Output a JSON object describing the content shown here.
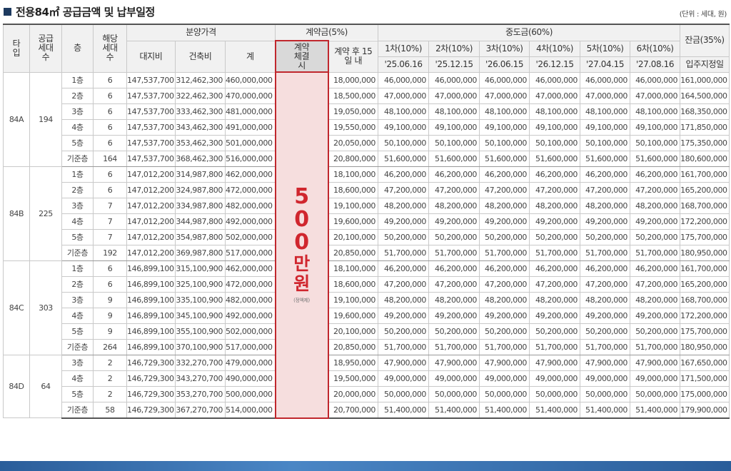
{
  "title": "전용84㎡ 공급금액 및 납부일정",
  "unit_note": "(단위 : 세대, 원)",
  "headers": {
    "type": "타입",
    "supply_units": "공급세대수",
    "floor": "층",
    "floor_units": "해당세대수",
    "price_group": "분양가격",
    "land": "대지비",
    "building": "건축비",
    "total": "계",
    "deposit_group": "계약금(5%)",
    "at_contract": "계약체결시",
    "within_15": "계약 후 15일 내",
    "middle_group": "중도금(60%)",
    "installments": [
      {
        "label": "1차(10%)",
        "date": "'25.06.16"
      },
      {
        "label": "2차(10%)",
        "date": "'25.12.15"
      },
      {
        "label": "3차(10%)",
        "date": "'26.06.15"
      },
      {
        "label": "4차(10%)",
        "date": "'26.12.15"
      },
      {
        "label": "5차(10%)",
        "date": "'27.04.15"
      },
      {
        "label": "6차(10%)",
        "date": "'27.08.16"
      }
    ],
    "balance": "잔금(35%)",
    "move_in": "입주지정일"
  },
  "contract_amount": {
    "digits": "500",
    "unit": "만원",
    "note": "(정액제)"
  },
  "groups": [
    {
      "type": "84A",
      "units": "194",
      "rows": [
        {
          "floor": "1층",
          "n": "6",
          "land": "147,537,700",
          "build": "312,462,300",
          "total": "460,000,000",
          "d15": "18,000,000",
          "mid": "46,000,000",
          "bal": "161,000,000"
        },
        {
          "floor": "2층",
          "n": "6",
          "land": "147,537,700",
          "build": "322,462,300",
          "total": "470,000,000",
          "d15": "18,500,000",
          "mid": "47,000,000",
          "bal": "164,500,000"
        },
        {
          "floor": "3층",
          "n": "6",
          "land": "147,537,700",
          "build": "333,462,300",
          "total": "481,000,000",
          "d15": "19,050,000",
          "mid": "48,100,000",
          "bal": "168,350,000"
        },
        {
          "floor": "4층",
          "n": "6",
          "land": "147,537,700",
          "build": "343,462,300",
          "total": "491,000,000",
          "d15": "19,550,000",
          "mid": "49,100,000",
          "bal": "171,850,000"
        },
        {
          "floor": "5층",
          "n": "6",
          "land": "147,537,700",
          "build": "353,462,300",
          "total": "501,000,000",
          "d15": "20,050,000",
          "mid": "50,100,000",
          "bal": "175,350,000"
        },
        {
          "floor": "기준층",
          "n": "164",
          "land": "147,537,700",
          "build": "368,462,300",
          "total": "516,000,000",
          "d15": "20,800,000",
          "mid": "51,600,000",
          "bal": "180,600,000"
        }
      ]
    },
    {
      "type": "84B",
      "units": "225",
      "rows": [
        {
          "floor": "1층",
          "n": "6",
          "land": "147,012,200",
          "build": "314,987,800",
          "total": "462,000,000",
          "d15": "18,100,000",
          "mid": "46,200,000",
          "bal": "161,700,000"
        },
        {
          "floor": "2층",
          "n": "6",
          "land": "147,012,200",
          "build": "324,987,800",
          "total": "472,000,000",
          "d15": "18,600,000",
          "mid": "47,200,000",
          "bal": "165,200,000"
        },
        {
          "floor": "3층",
          "n": "7",
          "land": "147,012,200",
          "build": "334,987,800",
          "total": "482,000,000",
          "d15": "19,100,000",
          "mid": "48,200,000",
          "bal": "168,700,000"
        },
        {
          "floor": "4층",
          "n": "7",
          "land": "147,012,200",
          "build": "344,987,800",
          "total": "492,000,000",
          "d15": "19,600,000",
          "mid": "49,200,000",
          "bal": "172,200,000"
        },
        {
          "floor": "5층",
          "n": "7",
          "land": "147,012,200",
          "build": "354,987,800",
          "total": "502,000,000",
          "d15": "20,100,000",
          "mid": "50,200,000",
          "bal": "175,700,000"
        },
        {
          "floor": "기준층",
          "n": "192",
          "land": "147,012,200",
          "build": "369,987,800",
          "total": "517,000,000",
          "d15": "20,850,000",
          "mid": "51,700,000",
          "bal": "180,950,000"
        }
      ]
    },
    {
      "type": "84C",
      "units": "303",
      "rows": [
        {
          "floor": "1층",
          "n": "6",
          "land": "146,899,100",
          "build": "315,100,900",
          "total": "462,000,000",
          "d15": "18,100,000",
          "mid": "46,200,000",
          "bal": "161,700,000"
        },
        {
          "floor": "2층",
          "n": "6",
          "land": "146,899,100",
          "build": "325,100,900",
          "total": "472,000,000",
          "d15": "18,600,000",
          "mid": "47,200,000",
          "bal": "165,200,000"
        },
        {
          "floor": "3층",
          "n": "9",
          "land": "146,899,100",
          "build": "335,100,900",
          "total": "482,000,000",
          "d15": "19,100,000",
          "mid": "48,200,000",
          "bal": "168,700,000"
        },
        {
          "floor": "4층",
          "n": "9",
          "land": "146,899,100",
          "build": "345,100,900",
          "total": "492,000,000",
          "d15": "19,600,000",
          "mid": "49,200,000",
          "bal": "172,200,000"
        },
        {
          "floor": "5층",
          "n": "9",
          "land": "146,899,100",
          "build": "355,100,900",
          "total": "502,000,000",
          "d15": "20,100,000",
          "mid": "50,200,000",
          "bal": "175,700,000"
        },
        {
          "floor": "기준층",
          "n": "264",
          "land": "146,899,100",
          "build": "370,100,900",
          "total": "517,000,000",
          "d15": "20,850,000",
          "mid": "51,700,000",
          "bal": "180,950,000"
        }
      ]
    },
    {
      "type": "84D",
      "units": "64",
      "rows": [
        {
          "floor": "3층",
          "n": "2",
          "land": "146,729,300",
          "build": "332,270,700",
          "total": "479,000,000",
          "d15": "18,950,000",
          "mid": "47,900,000",
          "bal": "167,650,000"
        },
        {
          "floor": "4층",
          "n": "2",
          "land": "146,729,300",
          "build": "343,270,700",
          "total": "490,000,000",
          "d15": "19,500,000",
          "mid": "49,000,000",
          "bal": "171,500,000"
        },
        {
          "floor": "5층",
          "n": "2",
          "land": "146,729,300",
          "build": "353,270,700",
          "total": "500,000,000",
          "d15": "20,000,000",
          "mid": "50,000,000",
          "bal": "175,000,000"
        },
        {
          "floor": "기준층",
          "n": "58",
          "land": "146,729,300",
          "build": "367,270,700",
          "total": "514,000,000",
          "d15": "20,700,000",
          "mid": "51,400,000",
          "bal": "179,900,000"
        }
      ]
    }
  ]
}
